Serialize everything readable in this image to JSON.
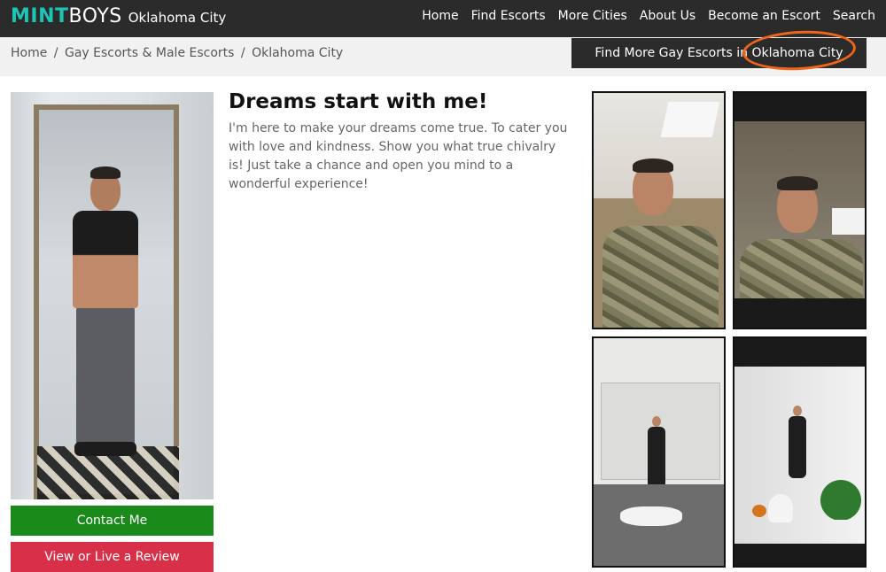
{
  "header": {
    "brand_mint": "MINT",
    "brand_boys": "BOYS",
    "city": "Oklahoma City",
    "nav": [
      "Home",
      "Find Escorts",
      "More Cities",
      "About Us",
      "Become an Escort",
      "Search"
    ]
  },
  "breadcrumb": {
    "items": [
      "Home",
      "Gay Escorts & Male Escorts",
      "Oklahoma City"
    ],
    "separator": "/"
  },
  "find_more_button": "Find More Gay Escorts in Oklahoma City",
  "profile": {
    "headline": "Dreams start with me!",
    "bio": "I'm here to make your dreams come true. To cater you with love and kindness. Show you what true chivalry is! Just take a chance and open you mind to a wonderful experience!",
    "contact_button": "Contact Me",
    "review_button": "View or Live a Review"
  },
  "colors": {
    "brand_teal": "#1ec4b5",
    "nav_bg": "#2b2b2b",
    "contact_green": "#1a8a1a",
    "review_red": "#d9304a",
    "highlight_orange": "#f0651c"
  },
  "gallery": {
    "photos": [
      "profile-main-photo",
      "gallery-photo-1",
      "gallery-photo-2",
      "gallery-photo-3",
      "gallery-photo-4"
    ]
  }
}
